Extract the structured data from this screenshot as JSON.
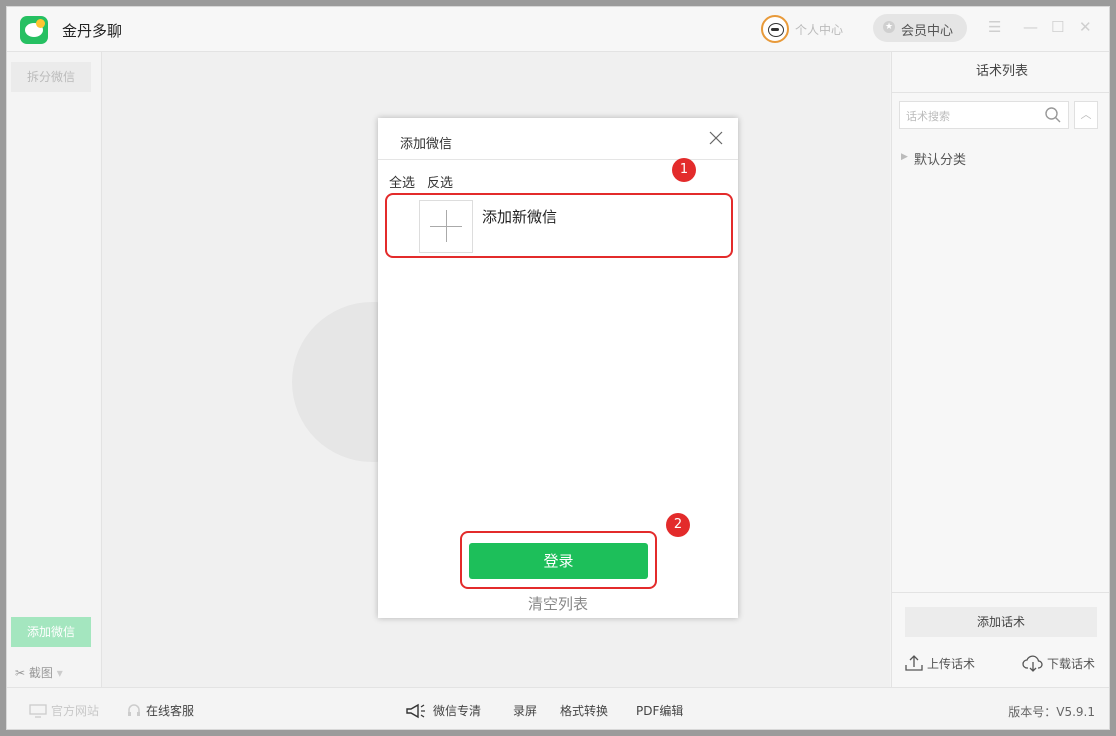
{
  "app": {
    "title": "金丹多聊"
  },
  "titlebar": {
    "personal_center": "个人中心",
    "member_center": "会员中心",
    "menu_icon": "☰",
    "minimize_icon": "—",
    "maximize_icon": "☐",
    "close_icon": "✕"
  },
  "left": {
    "split_wechat": "拆分微信",
    "add_wechat": "添加微信",
    "screenshot": "截图",
    "screenshot_arrow": "▾"
  },
  "right": {
    "title": "话术列表",
    "search_placeholder": "话术搜索",
    "collapse_icon": "︿",
    "category_arrow": "▶",
    "category": "默认分类",
    "add_script": "添加话术",
    "upload": "上传话术",
    "download": "下载话术"
  },
  "statusbar": {
    "official_site": "官方网站",
    "online_service": "在线客服",
    "wechat_clean": "微信专清",
    "record_screen": "录屏",
    "format_convert": "格式转换",
    "pdf_edit": "PDF编辑",
    "version": "版本号：V5.9.1"
  },
  "dialog": {
    "title": "添加微信",
    "select_all": "全选",
    "invert_select": "反选",
    "add_new": "添加新微信",
    "login": "登录",
    "clear_list": "清空列表"
  },
  "annotations": {
    "badge_1": "1",
    "badge_2": "2",
    "color": "#e32b2b"
  },
  "colors": {
    "brand_green": "#1dbf5a",
    "light_green": "#a4e6bf"
  }
}
